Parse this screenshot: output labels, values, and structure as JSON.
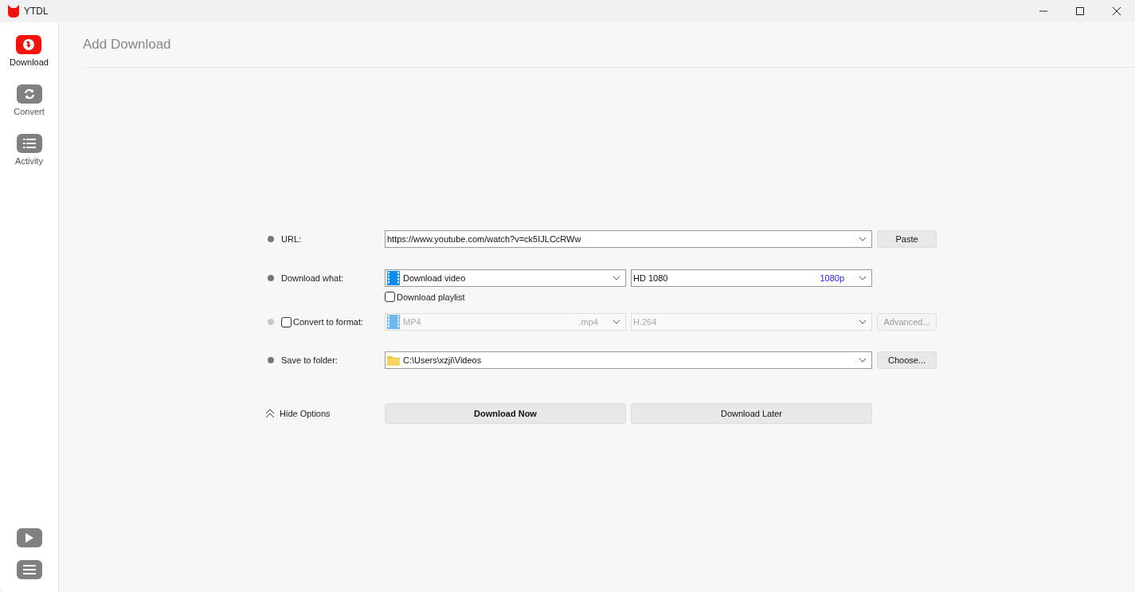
{
  "window": {
    "title": "YTDL"
  },
  "sidebar": {
    "items": [
      {
        "label": "Download",
        "kind": "download",
        "selected": true
      },
      {
        "label": "Convert",
        "kind": "convert",
        "selected": false
      },
      {
        "label": "Activity",
        "kind": "activity",
        "selected": false
      }
    ],
    "bottom_items": [
      {
        "kind": "play"
      },
      {
        "kind": "menu"
      }
    ]
  },
  "page": {
    "title": "Add Download"
  },
  "url": {
    "label": "URL:",
    "value": "https://www.youtube.com/watch?v=ck5IJLCcRWw",
    "button": "Paste"
  },
  "download_what": {
    "label": "Download what:",
    "type": "Download video",
    "quality": "HD 1080",
    "quality_tag": "1080p",
    "playlist": {
      "label": "Download playlist",
      "checked": false
    }
  },
  "convert": {
    "label": "Convert to format:",
    "checked": false,
    "format": "MP4",
    "extension": ".mp4",
    "codec": "H.264",
    "button": "Advanced..."
  },
  "save": {
    "label": "Save to folder:",
    "value": "C:\\Users\\xzji\\Videos",
    "button": "Choose..."
  },
  "options_toggle": {
    "label": "Hide Options",
    "expanded": true
  },
  "actions": [
    {
      "label": "Download Now",
      "primary": true
    },
    {
      "label": "Download Later",
      "primary": false
    }
  ]
}
